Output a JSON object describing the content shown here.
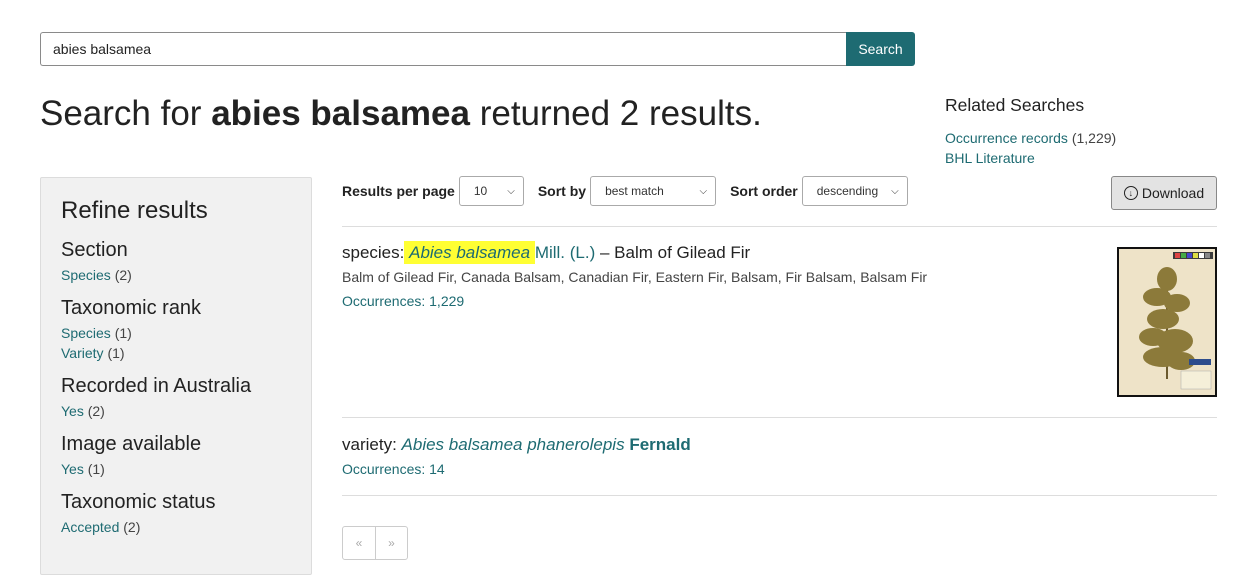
{
  "search": {
    "value": "abies balsamea",
    "button": "Search"
  },
  "heading": {
    "prefix": "Search for ",
    "query": "abies balsamea",
    "suffix": " returned 2 results."
  },
  "related": {
    "title": "Related Searches",
    "links": [
      {
        "label": "Occurrence records",
        "count": "(1,229)"
      },
      {
        "label": "BHL Literature",
        "count": ""
      }
    ]
  },
  "refine": {
    "title": "Refine results",
    "facets": [
      {
        "title": "Section",
        "items": [
          {
            "label": "Species",
            "count": "(2)"
          }
        ]
      },
      {
        "title": "Taxonomic rank",
        "items": [
          {
            "label": "Species",
            "count": "(1)"
          },
          {
            "label": "Variety",
            "count": "(1)"
          }
        ]
      },
      {
        "title": "Recorded in Australia",
        "items": [
          {
            "label": "Yes",
            "count": "(2)"
          }
        ]
      },
      {
        "title": "Image available",
        "items": [
          {
            "label": "Yes",
            "count": "(1)"
          }
        ]
      },
      {
        "title": "Taxonomic status",
        "items": [
          {
            "label": "Accepted",
            "count": "(2)"
          }
        ]
      }
    ]
  },
  "controls": {
    "per_page_label": "Results per page",
    "per_page_value": "10",
    "sort_by_label": "Sort by",
    "sort_by_value": "best match",
    "sort_order_label": "Sort order",
    "sort_order_value": "descending",
    "download": "Download"
  },
  "results": [
    {
      "rank": "species:",
      "sci_name": "Abies balsamea",
      "author": "Mill. (L.)",
      "common": "– Balm of Gilead Fir",
      "common_names": "Balm of Gilead Fir, Canada Balsam, Canadian Fir, Eastern Fir, Balsam, Fir Balsam, Balsam Fir",
      "occurrences": "Occurrences: 1,229"
    },
    {
      "rank": "variety:",
      "sci_name": "Abies balsamea phanerolepis",
      "author": "Fernald",
      "occurrences": "Occurrences: 14"
    }
  ],
  "pager": {
    "prev": "«",
    "next": "»"
  },
  "colors": {
    "accent": "#1e6b72",
    "highlight": "#ffff33"
  }
}
